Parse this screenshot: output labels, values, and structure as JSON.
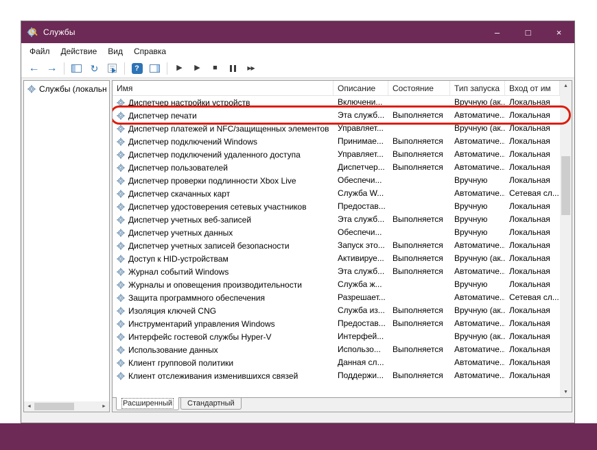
{
  "colors": {
    "titlebar": "#6d2a56",
    "taskband": "#6d2a56",
    "annotation": "#dc1d0e",
    "toolbar_accent": "#2d74b5"
  },
  "titlebar": {
    "title": "Службы",
    "minimize_glyph": "–",
    "maximize_glyph": "□",
    "close_glyph": "×"
  },
  "menu": {
    "items": [
      {
        "label": "Файл"
      },
      {
        "label": "Действие"
      },
      {
        "label": "Вид"
      },
      {
        "label": "Справка"
      }
    ]
  },
  "toolbar": {
    "back_glyph": "←",
    "forward_glyph": "→",
    "refresh_glyph": "↻",
    "help_glyph": "?",
    "start_glyph": "▶",
    "resume_glyph": "▶",
    "stop_glyph": "■",
    "restart_glyph": "▶▶"
  },
  "sidebar": {
    "root_item": "Службы (локальн"
  },
  "table": {
    "sort_indicator": "ˆ",
    "columns": [
      {
        "label": "Имя"
      },
      {
        "label": "Описание"
      },
      {
        "label": "Состояние"
      },
      {
        "label": "Тип запуска"
      },
      {
        "label": "Вход от им"
      }
    ],
    "rows": [
      {
        "name": "Диспетчер настройки устройств",
        "desc": "Включени...",
        "state": "",
        "startup": "Вручную (ак...",
        "login": "Локальная"
      },
      {
        "name": "Диспетчер печати",
        "desc": "Эта служб...",
        "state": "Выполняется",
        "startup": "Автоматиче...",
        "login": "Локальная",
        "highlighted": true
      },
      {
        "name": "Диспетчер платежей и NFC/защищенных элементов",
        "desc": "Управляет...",
        "state": "",
        "startup": "Вручную (ак...",
        "login": "Локальная"
      },
      {
        "name": "Диспетчер подключений Windows",
        "desc": "Принимае...",
        "state": "Выполняется",
        "startup": "Автоматиче...",
        "login": "Локальная"
      },
      {
        "name": "Диспетчер подключений удаленного доступа",
        "desc": "Управляет...",
        "state": "Выполняется",
        "startup": "Автоматиче...",
        "login": "Локальная"
      },
      {
        "name": "Диспетчер пользователей",
        "desc": "Диспетчер...",
        "state": "Выполняется",
        "startup": "Автоматиче...",
        "login": "Локальная"
      },
      {
        "name": "Диспетчер проверки подлинности Xbox Live",
        "desc": "Обеспечи...",
        "state": "",
        "startup": "Вручную",
        "login": "Локальная"
      },
      {
        "name": "Диспетчер скачанных карт",
        "desc": "Служба W...",
        "state": "",
        "startup": "Автоматиче...",
        "login": "Сетевая сл..."
      },
      {
        "name": "Диспетчер удостоверения сетевых участников",
        "desc": "Предостав...",
        "state": "",
        "startup": "Вручную",
        "login": "Локальная"
      },
      {
        "name": "Диспетчер учетных веб-записей",
        "desc": "Эта служб...",
        "state": "Выполняется",
        "startup": "Вручную",
        "login": "Локальная"
      },
      {
        "name": "Диспетчер учетных данных",
        "desc": "Обеспечи...",
        "state": "",
        "startup": "Вручную",
        "login": "Локальная"
      },
      {
        "name": "Диспетчер учетных записей безопасности",
        "desc": "Запуск это...",
        "state": "Выполняется",
        "startup": "Автоматиче...",
        "login": "Локальная"
      },
      {
        "name": "Доступ к HID-устройствам",
        "desc": "Активируе...",
        "state": "Выполняется",
        "startup": "Вручную (ак...",
        "login": "Локальная"
      },
      {
        "name": "Журнал событий Windows",
        "desc": "Эта служб...",
        "state": "Выполняется",
        "startup": "Автоматиче...",
        "login": "Локальная"
      },
      {
        "name": "Журналы и оповещения производительности",
        "desc": "Служба ж...",
        "state": "",
        "startup": "Вручную",
        "login": "Локальная"
      },
      {
        "name": "Защита программного обеспечения",
        "desc": "Разрешает...",
        "state": "",
        "startup": "Автоматиче...",
        "login": "Сетевая сл..."
      },
      {
        "name": "Изоляция ключей CNG",
        "desc": "Служба из...",
        "state": "Выполняется",
        "startup": "Вручную (ак...",
        "login": "Локальная"
      },
      {
        "name": "Инструментарий управления Windows",
        "desc": "Предостав...",
        "state": "Выполняется",
        "startup": "Автоматиче...",
        "login": "Локальная"
      },
      {
        "name": "Интерфейс гостевой службы Hyper-V",
        "desc": "Интерфей...",
        "state": "",
        "startup": "Вручную (ак...",
        "login": "Локальная"
      },
      {
        "name": "Использование данных",
        "desc": "Использо...",
        "state": "Выполняется",
        "startup": "Автоматиче...",
        "login": "Локальная"
      },
      {
        "name": "Клиент групповой политики",
        "desc": "Данная сл...",
        "state": "",
        "startup": "Автоматиче...",
        "login": "Локальная"
      },
      {
        "name": "Клиент отслеживания изменившихся связей",
        "desc": "Поддержи...",
        "state": "Выполняется",
        "startup": "Автоматиче...",
        "login": "Локальная"
      }
    ]
  },
  "tabs": {
    "items": [
      {
        "label": "Расширенный",
        "active": true
      },
      {
        "label": "Стандартный"
      }
    ]
  },
  "scrollbar": {
    "up": "▲",
    "down": "▼",
    "left": "◄",
    "right": "►"
  }
}
